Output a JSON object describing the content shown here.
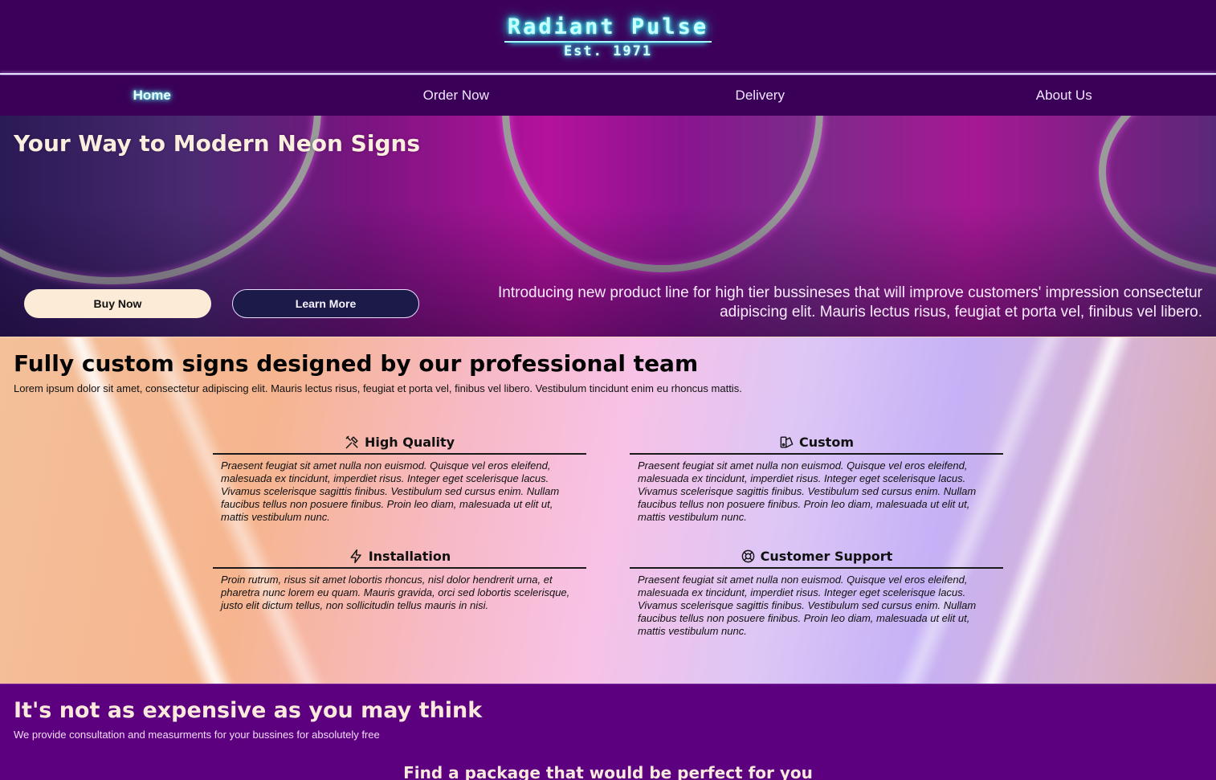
{
  "header": {
    "brand": "Radiant Pulse",
    "established": "Est. 1971"
  },
  "nav": {
    "items": [
      {
        "label": "Home",
        "active": true
      },
      {
        "label": "Order Now",
        "active": false
      },
      {
        "label": "Delivery",
        "active": false
      },
      {
        "label": "About Us",
        "active": false
      }
    ]
  },
  "hero": {
    "title": "Your Way to Modern Neon Signs",
    "buy_label": "Buy Now",
    "learn_label": "Learn More",
    "intro": "Introducing new product line for high tier bussineses that will improve customers' impression consectetur adipiscing elit. Mauris lectus risus, feugiat et porta vel, finibus vel libero."
  },
  "features": {
    "title": "Fully custom signs designed by our professional team",
    "lead": "Lorem ipsum dolor sit amet, consectetur adipiscing elit. Mauris lectus risus, feugiat et porta vel, finibus vel libero. Vestibulum tincidunt enim eu rhoncus mattis.",
    "cards": [
      {
        "icon": "tools-icon",
        "title": "High Quality",
        "text": "Praesent feugiat sit amet nulla non euismod. Quisque vel eros eleifend, malesuada ex tincidunt, imperdiet risus. Integer eget scelerisque lacus. Vivamus scelerisque sagittis finibus. Vestibulum sed cursus enim. Nullam faucibus tellus non posuere finibus. Proin leo diam, malesuada ut elit ut, mattis vestibulum nunc."
      },
      {
        "icon": "palette-icon",
        "title": "Custom",
        "text": "Praesent feugiat sit amet nulla non euismod. Quisque vel eros eleifend, malesuada ex tincidunt, imperdiet risus. Integer eget scelerisque lacus. Vivamus scelerisque sagittis finibus. Vestibulum sed cursus enim. Nullam faucibus tellus non posuere finibus. Proin leo diam, malesuada ut elit ut, mattis vestibulum nunc."
      },
      {
        "icon": "lightning-icon",
        "title": "Installation",
        "text": "Proin rutrum, risus sit amet lobortis rhoncus, nisl dolor hendrerit urna, et pharetra nunc lorem eu quam. Mauris gravida, orci sed lobortis scelerisque, justo elit dictum tellus, non sollicitudin tellus mauris in nisi."
      },
      {
        "icon": "lifebuoy-icon",
        "title": "Customer Support",
        "text": "Praesent feugiat sit amet nulla non euismod. Quisque vel eros eleifend, malesuada ex tincidunt, imperdiet risus. Integer eget scelerisque lacus. Vivamus scelerisque sagittis finibus. Vestibulum sed cursus enim. Nullam faucibus tellus non posuere finibus. Proin leo diam, malesuada ut elit ut, mattis vestibulum nunc."
      }
    ]
  },
  "pricing": {
    "title": "It's not as expensive as you may think",
    "lead": "We provide consultation and measurments for your bussines for absolutely free",
    "subtitle": "Find a package that would be perfect for you"
  }
}
